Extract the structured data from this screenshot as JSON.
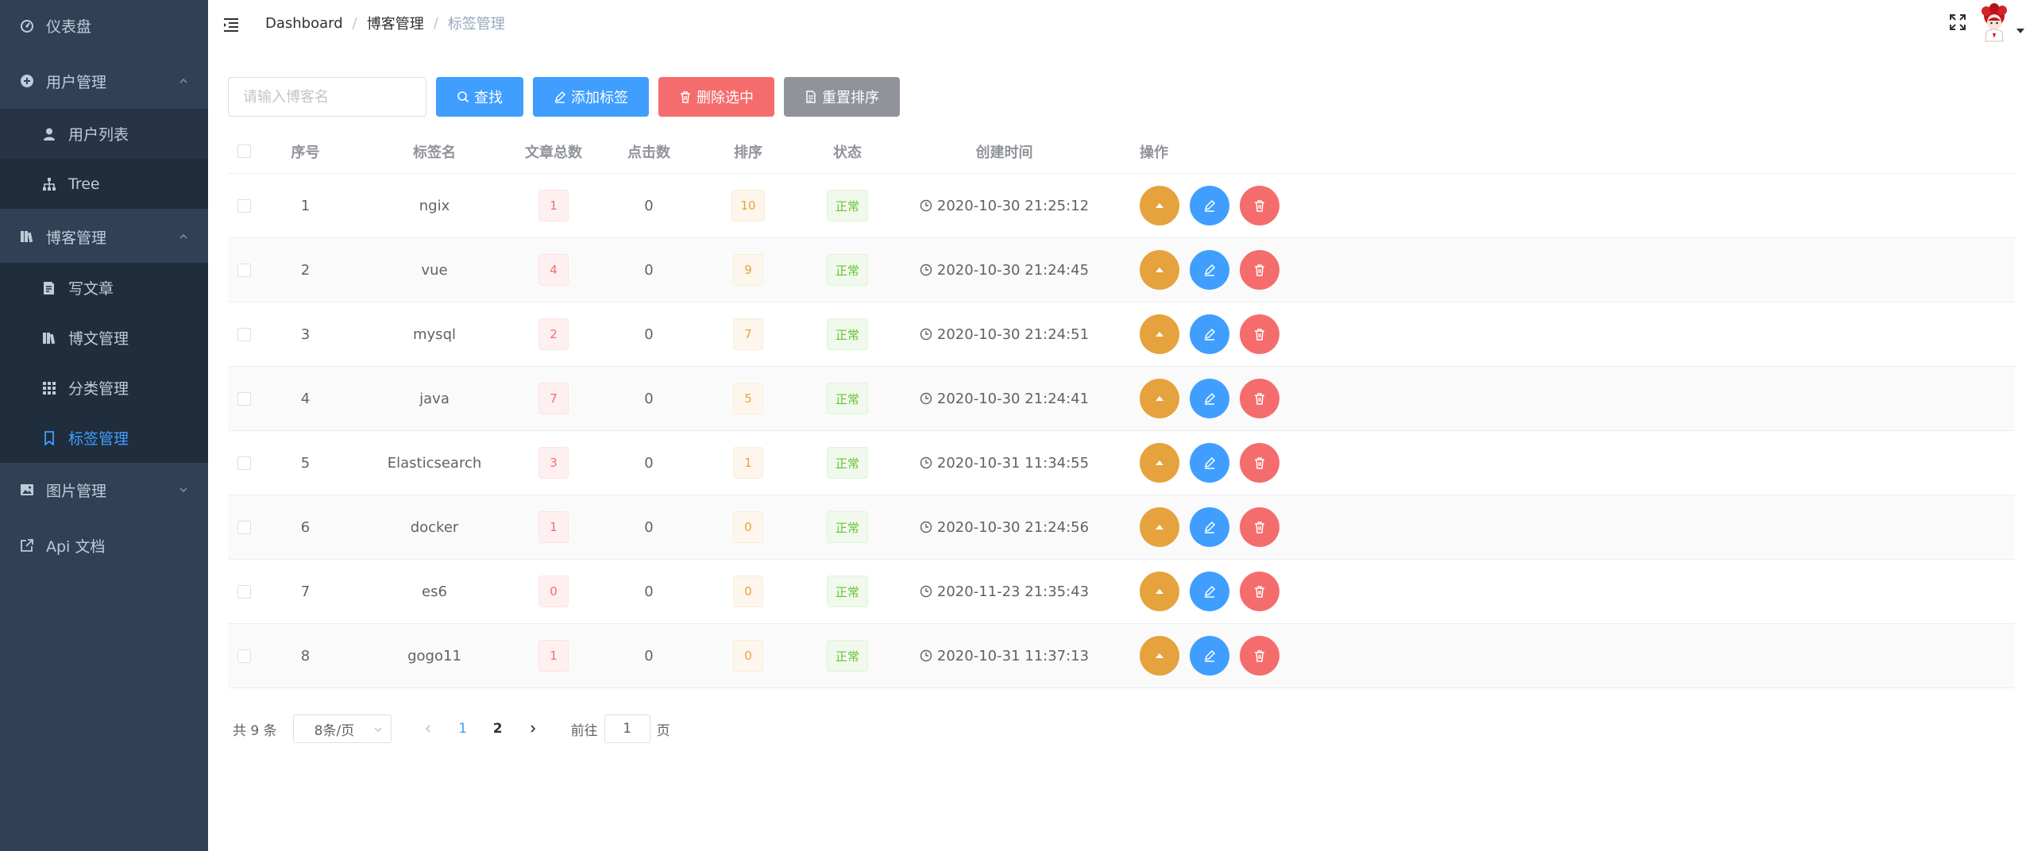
{
  "sidebar": {
    "items": [
      {
        "label": "仪表盘"
      },
      {
        "label": "用户管理"
      },
      {
        "label": "用户列表"
      },
      {
        "label": "Tree"
      },
      {
        "label": "博客管理"
      },
      {
        "label": "写文章"
      },
      {
        "label": "博文管理"
      },
      {
        "label": "分类管理"
      },
      {
        "label": "标签管理"
      },
      {
        "label": "图片管理"
      },
      {
        "label": "Api 文档"
      }
    ]
  },
  "breadcrumb": [
    "Dashboard",
    "博客管理",
    "标签管理"
  ],
  "filter": {
    "placeholder": "请输入博客名",
    "search_label": "查找",
    "add_label": "添加标签",
    "delete_label": "删除选中",
    "reset_label": "重置排序"
  },
  "table": {
    "headers": [
      "序号",
      "标签名",
      "文章总数",
      "点击数",
      "排序",
      "状态",
      "创建时间",
      "操作"
    ],
    "rows": [
      {
        "idx": "1",
        "name": "ngix",
        "count": "1",
        "clicks": "0",
        "sort": "10",
        "status": "正常",
        "time": "2020-10-30 21:25:12"
      },
      {
        "idx": "2",
        "name": "vue",
        "count": "4",
        "clicks": "0",
        "sort": "9",
        "status": "正常",
        "time": "2020-10-30 21:24:45"
      },
      {
        "idx": "3",
        "name": "mysql",
        "count": "2",
        "clicks": "0",
        "sort": "7",
        "status": "正常",
        "time": "2020-10-30 21:24:51"
      },
      {
        "idx": "4",
        "name": "java",
        "count": "7",
        "clicks": "0",
        "sort": "5",
        "status": "正常",
        "time": "2020-10-30 21:24:41"
      },
      {
        "idx": "5",
        "name": "Elasticsearch",
        "count": "3",
        "clicks": "0",
        "sort": "1",
        "status": "正常",
        "time": "2020-10-31 11:34:55"
      },
      {
        "idx": "6",
        "name": "docker",
        "count": "1",
        "clicks": "0",
        "sort": "0",
        "status": "正常",
        "time": "2020-10-30 21:24:56"
      },
      {
        "idx": "7",
        "name": "es6",
        "count": "0",
        "clicks": "0",
        "sort": "0",
        "status": "正常",
        "time": "2020-11-23 21:35:43"
      },
      {
        "idx": "8",
        "name": "gogo11",
        "count": "1",
        "clicks": "0",
        "sort": "0",
        "status": "正常",
        "time": "2020-10-31 11:37:13"
      }
    ]
  },
  "pagination": {
    "total_text": "共 9 条",
    "page_size": "8条/页",
    "pages": [
      "1",
      "2"
    ],
    "goto_prefix": "前往",
    "goto_value": "1",
    "goto_suffix": "页"
  },
  "colors": {
    "sidebar_bg": "#304156",
    "submenu_bg": "#1f2d3d",
    "active": "#409eff",
    "primary": "#409eff",
    "danger": "#f56c6c",
    "warning": "#e6a23c",
    "info": "#909399",
    "success": "#67c23a"
  }
}
